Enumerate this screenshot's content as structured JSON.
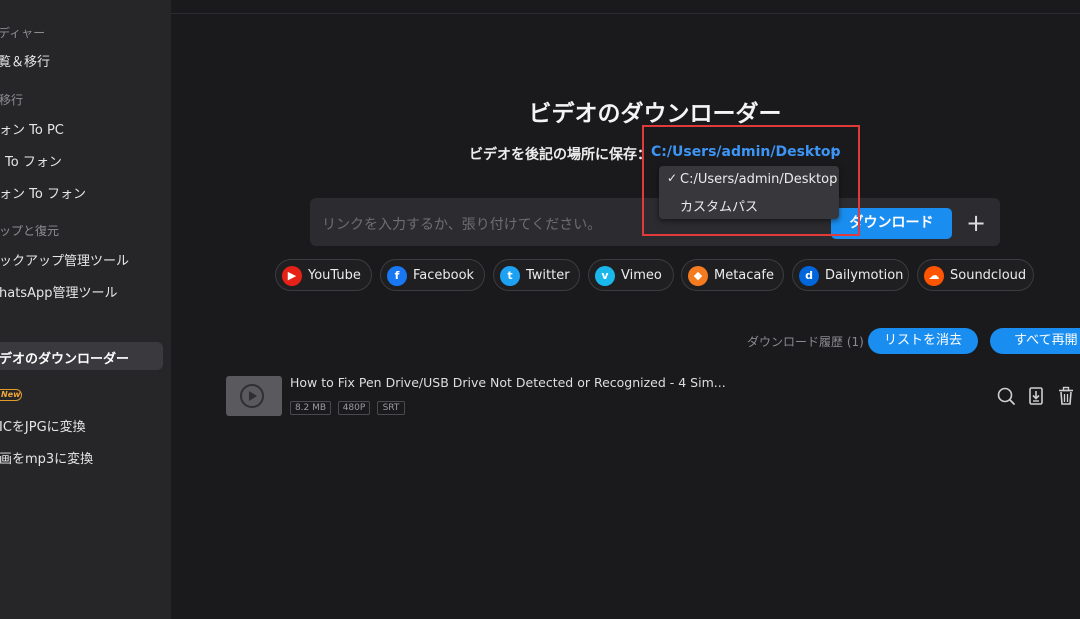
{
  "sidebar": {
    "items": [
      {
        "label": "ディャー",
        "type": "section"
      },
      {
        "label": "覧＆移行",
        "type": "item"
      },
      {
        "label": "移行",
        "type": "section"
      },
      {
        "label": "ォン To PC",
        "type": "item"
      },
      {
        "label": "To フォン",
        "type": "item"
      },
      {
        "label": "ォン To フォン",
        "type": "item"
      },
      {
        "label": "ップと復元",
        "type": "section"
      },
      {
        "label": "ックアップ管理ツール",
        "type": "item"
      },
      {
        "label": "hatsApp管理ツール",
        "type": "item"
      },
      {
        "label": "デオのダウンローダー",
        "type": "item",
        "active": true
      },
      {
        "label": "New",
        "type": "badge"
      },
      {
        "label": "ICをJPGに変換",
        "type": "item"
      },
      {
        "label": "画をmp3に変換",
        "type": "item"
      }
    ]
  },
  "main": {
    "title": "ビデオのダウンローダー",
    "save_label": "ビデオを後記の場所に保存：",
    "save_path": "C:/Users/admin/Desktop",
    "dropdown": {
      "options": [
        "C:/Users/admin/Desktop",
        "カスタムパス"
      ],
      "selected": "C:/Users/admin/Desktop"
    },
    "url_placeholder": "リンクを入力するか、張り付けてください。",
    "download_button": "ダウンロード",
    "platforms": [
      {
        "name": "YouTube",
        "icon": "youtube-icon",
        "color": "#e62117"
      },
      {
        "name": "Facebook",
        "icon": "facebook-icon",
        "color": "#1877f2"
      },
      {
        "name": "Twitter",
        "icon": "twitter-icon",
        "color": "#1da1f2"
      },
      {
        "name": "Vimeo",
        "icon": "vimeo-icon",
        "color": "#1ab7ea"
      },
      {
        "name": "Metacafe",
        "icon": "metacafe-icon",
        "color": "#f47b20"
      },
      {
        "name": "Dailymotion",
        "icon": "dailymotion-icon",
        "color": "#0066dc"
      },
      {
        "name": "Soundcloud",
        "icon": "soundcloud-icon",
        "color": "#ff5500"
      }
    ],
    "history": {
      "label": "ダウンロード履歴 (1)",
      "clear_button": "リストを消去",
      "resume_button": "すべて再開"
    },
    "items": [
      {
        "title": "How to Fix Pen Drive/USB Drive Not Detected or Recognized - 4 Sim...",
        "size": "8.2 MB",
        "quality": "480P",
        "subtitle": "SRT"
      }
    ]
  },
  "colors": {
    "accent": "#1a8ef0",
    "path_link": "#3d95f5",
    "highlight_box": "#e03a3a",
    "new_badge": "#f0a63a"
  }
}
